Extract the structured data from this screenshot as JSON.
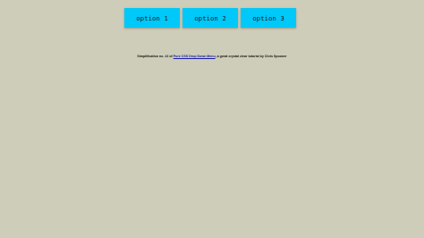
{
  "menu": {
    "items": [
      {
        "label": "option 1"
      },
      {
        "label": "option 2"
      },
      {
        "label": "option 3"
      }
    ],
    "color": "#00c8f8"
  },
  "caption": {
    "prefix": "Simplification no. #2 of ",
    "link_text": "Pure CSS Drop Down Menu",
    "suffix": ", a great crystal clear tutorial by Chris Spooner"
  },
  "background_color": "#cdcdb9"
}
